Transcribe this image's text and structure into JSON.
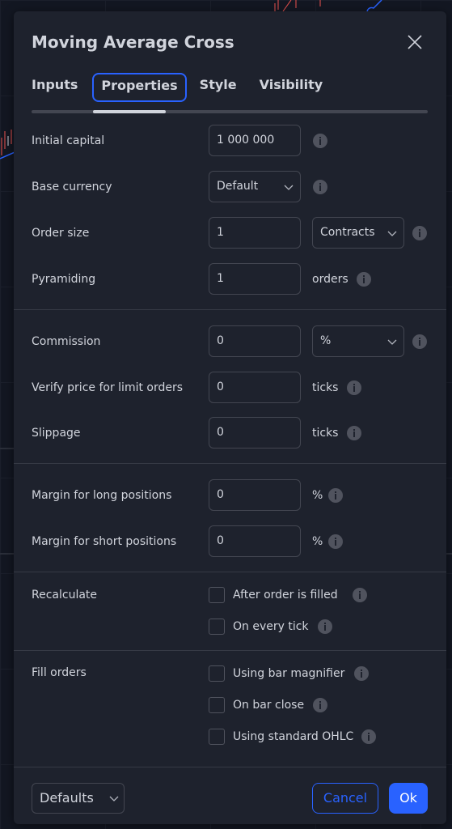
{
  "dialog": {
    "title": "Moving Average Cross",
    "close_icon": "close-icon"
  },
  "tabs": [
    {
      "label": "Inputs",
      "active": false
    },
    {
      "label": "Properties",
      "active": true
    },
    {
      "label": "Style",
      "active": false
    },
    {
      "label": "Visibility",
      "active": false
    }
  ],
  "fields": {
    "initial_capital": {
      "label": "Initial capital",
      "value": "1 000 000"
    },
    "base_currency": {
      "label": "Base currency",
      "value": "Default"
    },
    "order_size": {
      "label": "Order size",
      "value": "1",
      "unit": "Contracts"
    },
    "pyramiding": {
      "label": "Pyramiding",
      "value": "1",
      "suffix": "orders"
    },
    "commission": {
      "label": "Commission",
      "value": "0",
      "unit": "%"
    },
    "verify_price": {
      "label": "Verify price for limit orders",
      "value": "0",
      "suffix": "ticks"
    },
    "slippage": {
      "label": "Slippage",
      "value": "0",
      "suffix": "ticks"
    },
    "margin_long": {
      "label": "Margin for long positions",
      "value": "0",
      "suffix": "%"
    },
    "margin_short": {
      "label": "Margin for short positions",
      "value": "0",
      "suffix": "%"
    }
  },
  "recalculate": {
    "label": "Recalculate",
    "options": [
      {
        "label": "After order is filled",
        "checked": false
      },
      {
        "label": "On every tick",
        "checked": false
      }
    ]
  },
  "fill_orders": {
    "label": "Fill orders",
    "options": [
      {
        "label": "Using bar magnifier",
        "checked": false
      },
      {
        "label": "On bar close",
        "checked": false
      },
      {
        "label": "Using standard OHLC",
        "checked": false
      }
    ]
  },
  "footer": {
    "defaults_label": "Defaults",
    "cancel_label": "Cancel",
    "ok_label": "Ok"
  },
  "colors": {
    "accent": "#2962ff",
    "dialog_bg": "#1e222d",
    "page_bg": "#131722",
    "text": "#d1d4dc"
  }
}
